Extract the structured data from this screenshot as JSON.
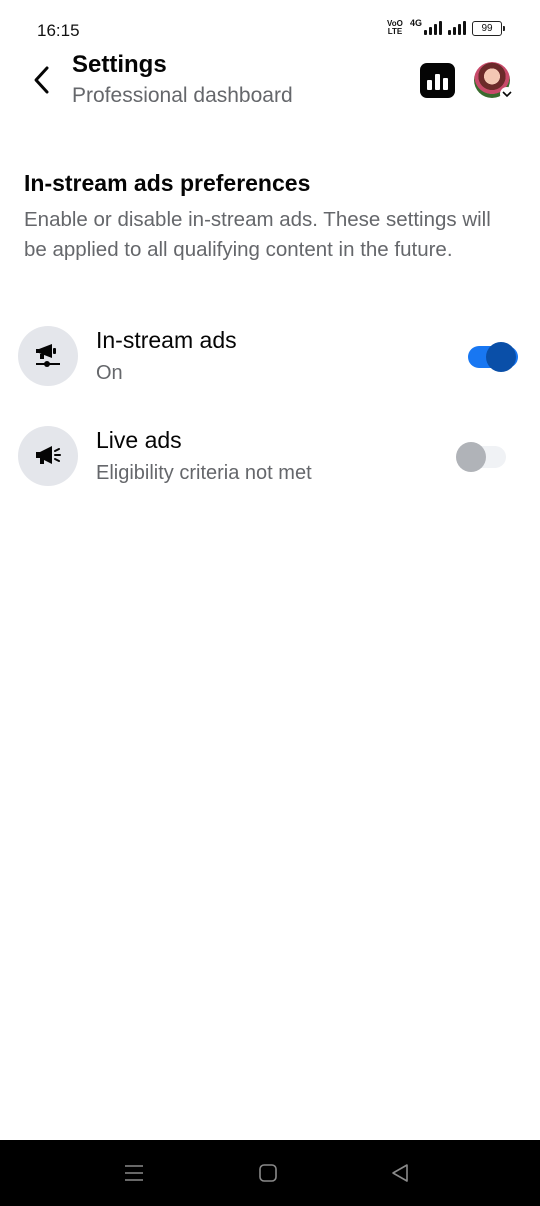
{
  "status_bar": {
    "time": "16:15",
    "volte_top": "VoO",
    "volte_bottom": "LTE",
    "network": "4G",
    "battery": "99"
  },
  "header": {
    "title": "Settings",
    "subtitle": "Professional dashboard",
    "back_icon": "chevron-left-icon",
    "insights_icon": "bar-chart-icon"
  },
  "section": {
    "title": "In-stream ads preferences",
    "description": "Enable or disable in-stream ads. These settings will be applied to all qualifying content in the future."
  },
  "settings": [
    {
      "title": "In-stream ads",
      "status": "On",
      "icon": "in-stream-ads-icon",
      "enabled": true
    },
    {
      "title": "Live ads",
      "status": "Eligibility criteria not met",
      "icon": "megaphone-icon",
      "enabled": false
    }
  ],
  "nav": {
    "recents_icon": "menu-icon",
    "home_icon": "square-icon",
    "back_icon": "triangle-back-icon"
  },
  "colors": {
    "accent": "#1877f2",
    "toggle_knob_on": "#0a4fa8",
    "secondary_text": "#65676b",
    "icon_bg": "#e4e6eb"
  }
}
